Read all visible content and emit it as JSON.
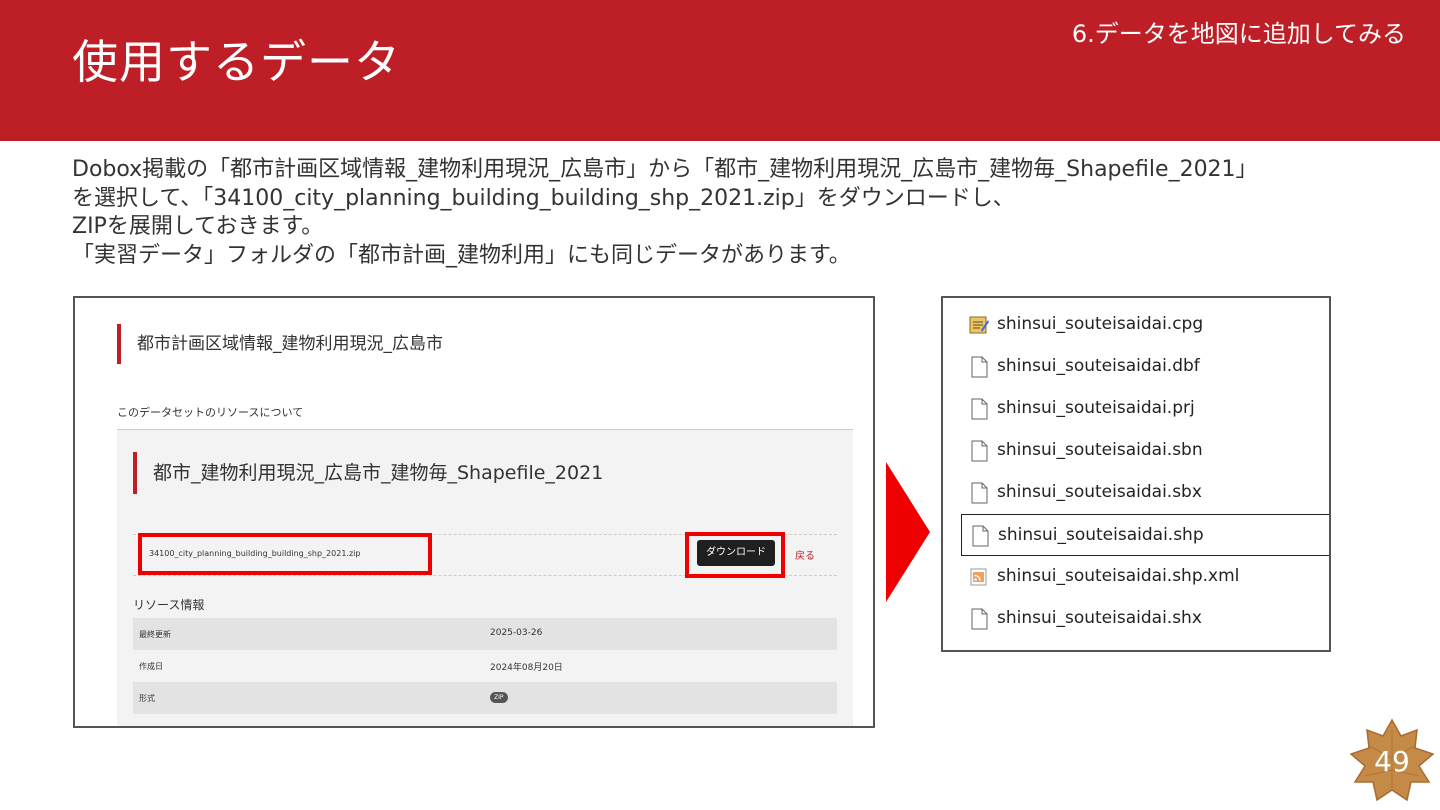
{
  "header": {
    "title": "使用するデータ",
    "section": "6.データを地図に追加してみる"
  },
  "intro": {
    "lines": [
      "Dobox掲載の「都市計画区域情報_建物利用現況_広島市」から「都市_建物利用現況_広島市_建物毎_Shapefile_2021」",
      "を選択して、「34100_city_planning_building_building_shp_2021.zip」をダウンロードし、",
      "ZIPを展開しておきます。",
      "「実習データ」フォルダの「都市計画_建物利用」にも同じデータがあります。"
    ]
  },
  "dataset_page": {
    "dataset_title": "都市計画区域情報_建物利用現況_広島市",
    "resources_heading": "このデータセットのリソースについて",
    "resource_title": "都市_建物利用現況_広島市_建物毎_Shapefile_2021",
    "file_name": "34100_city_planning_building_building_shp_2021.zip",
    "download_label": "ダウンロード",
    "back_label": "戻る",
    "info_heading": "リソース情報",
    "info_rows": [
      {
        "key": "最終更新",
        "value": "2025-03-26"
      },
      {
        "key": "作成日",
        "value": "2024年08月20日"
      },
      {
        "key": "形式",
        "value": "ZIP"
      }
    ]
  },
  "file_list": [
    {
      "name": "shinsui_souteisaidai.cpg",
      "icon": "text-file-icon"
    },
    {
      "name": "shinsui_souteisaidai.dbf",
      "icon": "file-icon"
    },
    {
      "name": "shinsui_souteisaidai.prj",
      "icon": "file-icon"
    },
    {
      "name": "shinsui_souteisaidai.sbn",
      "icon": "file-icon"
    },
    {
      "name": "shinsui_souteisaidai.sbx",
      "icon": "file-icon"
    },
    {
      "name": "shinsui_souteisaidai.shp",
      "icon": "file-icon",
      "selected": true
    },
    {
      "name": "shinsui_souteisaidai.shp.xml",
      "icon": "xml-file-icon"
    },
    {
      "name": "shinsui_souteisaidai.shx",
      "icon": "file-icon"
    }
  ],
  "page_number": "49",
  "colors": {
    "brand_red": "#be1e26",
    "highlight_red": "#ee0000",
    "badge_brown": "#c58a47"
  }
}
